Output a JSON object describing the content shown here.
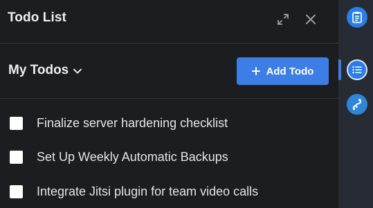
{
  "header": {
    "title": "Todo List"
  },
  "section": {
    "title": "My Todos"
  },
  "toolbar": {
    "add_label": "Add Todo"
  },
  "todos": [
    {
      "text": "Finalize server hardening checklist",
      "checked": false
    },
    {
      "text": "Set Up Weekly Automatic Backups",
      "checked": false
    },
    {
      "text": "Integrate Jitsi plugin for team video calls",
      "checked": false
    }
  ],
  "icons": {
    "expand": "expand-icon",
    "close": "close-icon",
    "chevron": "chevron-down-icon",
    "plus": "plus-icon",
    "rail": [
      "clipboard-icon",
      "list-icon",
      "jitsi-icon"
    ]
  },
  "colors": {
    "accent": "#3d7de6",
    "panel_bg": "#1c1d21",
    "rail_bg": "#272b33"
  }
}
